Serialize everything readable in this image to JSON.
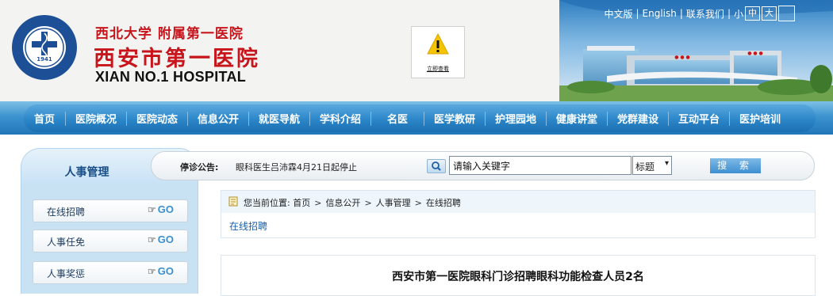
{
  "header": {
    "logo_seal_top": "西安市第一医院",
    "logo_seal_bottom": "西北大学附属第一医院",
    "logo_seal_year": "1941",
    "logo_cn_top": "西北大学 附属第一医院",
    "logo_cn_main": "西安市第一医院",
    "logo_en": "XIAN NO.1 HOSPITAL",
    "notice_link": "立即查看",
    "notice_icon": "warning-icon"
  },
  "util": {
    "lang_cn": "中文版",
    "lang_en": "English",
    "contact": "联系我们",
    "font_small": "小",
    "font_medium": "中",
    "font_large": "大"
  },
  "nav": {
    "items": [
      "首页",
      "医院概况",
      "医院动态",
      "信息公开",
      "就医导航",
      "学科介绍",
      "名医",
      "医学教研",
      "护理园地",
      "健康讲堂",
      "党群建设",
      "互动平台",
      "医护培训"
    ]
  },
  "sidebar": {
    "title": "人事管理",
    "go_label": "GO",
    "items": [
      {
        "label": "在线招聘"
      },
      {
        "label": "人事任免"
      },
      {
        "label": "人事奖惩"
      }
    ]
  },
  "search": {
    "notice_label": "停诊公告:",
    "notice_text": "眼科医生吕沛霖4月21日起停止",
    "input_value": "请输入关键字",
    "select_value": "标题",
    "button_label": "搜 索"
  },
  "breadcrumb": {
    "prefix": "您当前位置:",
    "items": [
      "首页",
      "信息公开",
      "人事管理",
      "在线招聘"
    ]
  },
  "section": {
    "title": "在线招聘"
  },
  "article": {
    "title": "西安市第一医院眼科门诊招聘眼科功能检查人员2名"
  },
  "colors": {
    "brand_red": "#c8141b",
    "nav_blue": "#2b86c8",
    "link_blue": "#1a5fa6"
  }
}
